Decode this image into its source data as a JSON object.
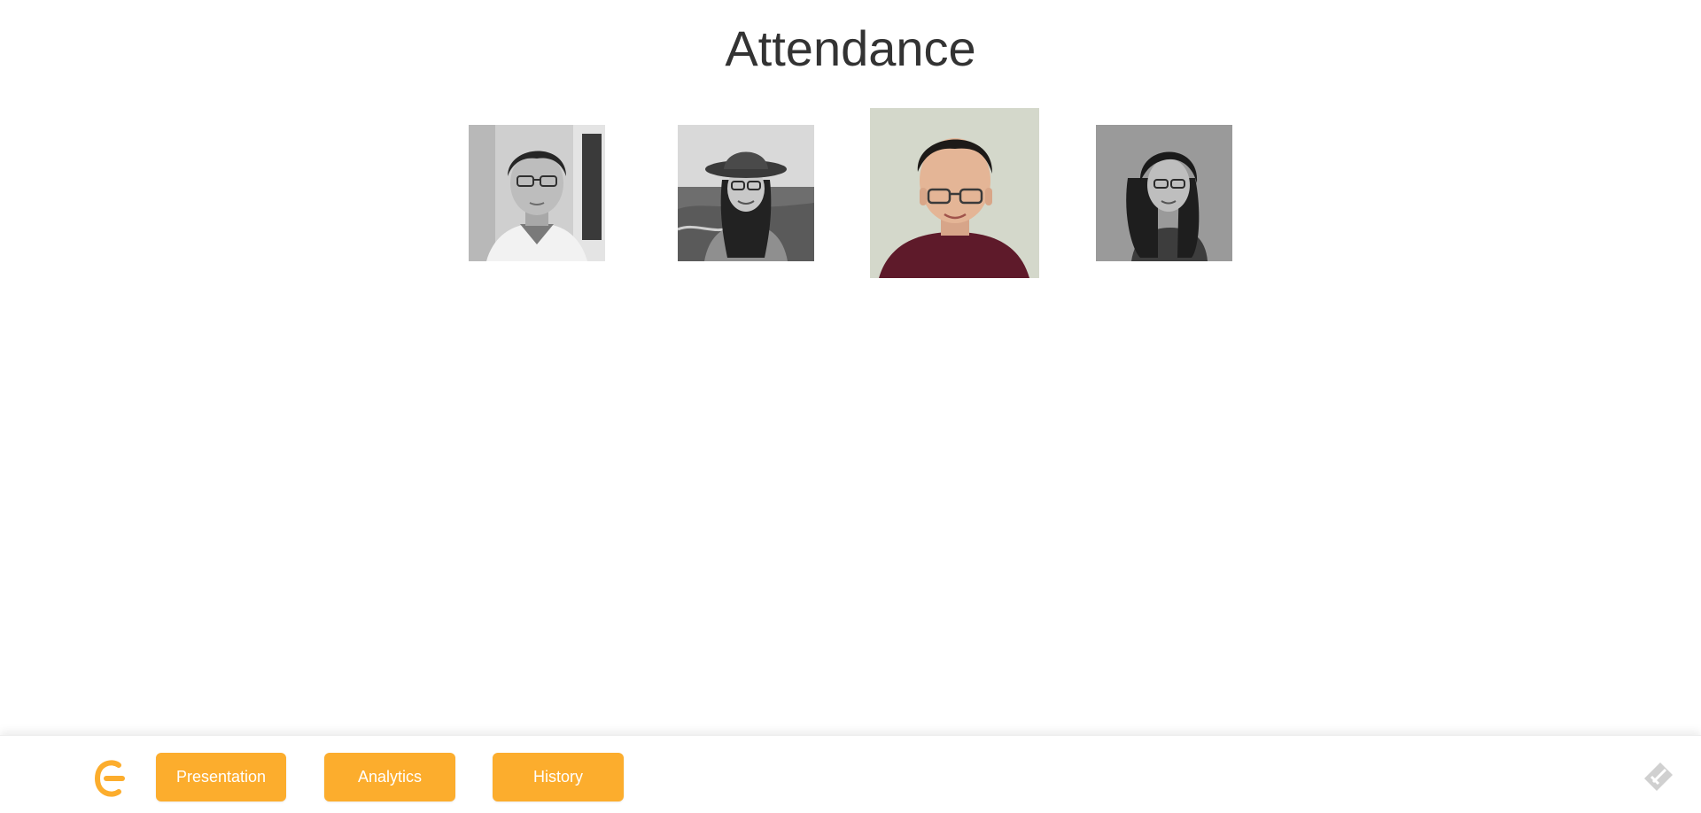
{
  "page": {
    "title": "Attendance"
  },
  "attendees": [
    {
      "name": "attendee-1",
      "color": "grayscale"
    },
    {
      "name": "attendee-2",
      "color": "grayscale"
    },
    {
      "name": "attendee-3",
      "color": "color",
      "highlighted": true
    },
    {
      "name": "attendee-4",
      "color": "grayscale"
    }
  ],
  "toolbar": {
    "logo_icon": "brand-logo-icon",
    "buttons": [
      {
        "label": "Presentation"
      },
      {
        "label": "Analytics"
      },
      {
        "label": "History"
      }
    ],
    "right_icon": "tag-icon"
  },
  "colors": {
    "accent": "#fcad2d",
    "title_text": "#333333",
    "button_text": "#ffffff",
    "icon_gray": "#cccccc"
  }
}
